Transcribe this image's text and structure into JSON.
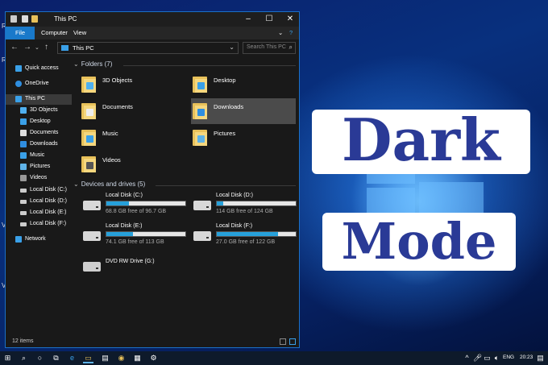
{
  "window": {
    "title": "This PC",
    "controls": [
      "minimize",
      "maximize",
      "close"
    ]
  },
  "ribbon": {
    "tabs": [
      "File",
      "Computer",
      "View"
    ]
  },
  "address": {
    "path": "This PC",
    "search_placeholder": "Search This PC"
  },
  "sidebar": {
    "items": [
      {
        "label": "Quick access",
        "icon": "star-icon"
      },
      {
        "label": "OneDrive",
        "icon": "cloud-icon"
      },
      {
        "label": "This PC",
        "icon": "computer-icon",
        "selected": true
      },
      {
        "label": "3D Objects",
        "icon": "cube-icon"
      },
      {
        "label": "Desktop",
        "icon": "desktop-icon"
      },
      {
        "label": "Documents",
        "icon": "document-icon"
      },
      {
        "label": "Downloads",
        "icon": "download-icon"
      },
      {
        "label": "Music",
        "icon": "music-icon"
      },
      {
        "label": "Pictures",
        "icon": "picture-icon"
      },
      {
        "label": "Videos",
        "icon": "video-icon"
      },
      {
        "label": "Local Disk (C:)",
        "icon": "drive-icon"
      },
      {
        "label": "Local Disk (D:)",
        "icon": "drive-icon"
      },
      {
        "label": "Local Disk (E:)",
        "icon": "drive-icon"
      },
      {
        "label": "Local Disk (F:)",
        "icon": "drive-icon"
      },
      {
        "label": "Network",
        "icon": "network-icon"
      }
    ]
  },
  "folders": {
    "header": "Folders (7)",
    "items": [
      "3D Objects",
      "Desktop",
      "Documents",
      "Downloads",
      "Music",
      "Pictures",
      "Videos"
    ]
  },
  "drives": {
    "header": "Devices and drives (5)",
    "items": [
      {
        "name": "Local Disk (C:)",
        "free": "68.8 GB free of 96.7 GB",
        "used_fraction": 0.29
      },
      {
        "name": "Local Disk (D:)",
        "free": "114 GB free of 124 GB",
        "used_fraction": 0.08
      },
      {
        "name": "Local Disk (E:)",
        "free": "74.1 GB free of 113 GB",
        "used_fraction": 0.34
      },
      {
        "name": "Local Disk (F:)",
        "free": "27.0 GB free of 122 GB",
        "used_fraction": 0.78
      },
      {
        "name": "DVD RW Drive (G:)",
        "free": ""
      }
    ]
  },
  "status": {
    "items": "12 items"
  },
  "overlay": {
    "line1": "Dark",
    "line2": "Mode"
  },
  "taskbar": {
    "language": "ENG",
    "time": "20:23"
  },
  "desktop_letters": [
    "R",
    "R",
    "V",
    "V"
  ],
  "colors": {
    "accent": "#1979ca",
    "drive_bar": "#26a0da",
    "overlay_text": "#2a3a96"
  }
}
